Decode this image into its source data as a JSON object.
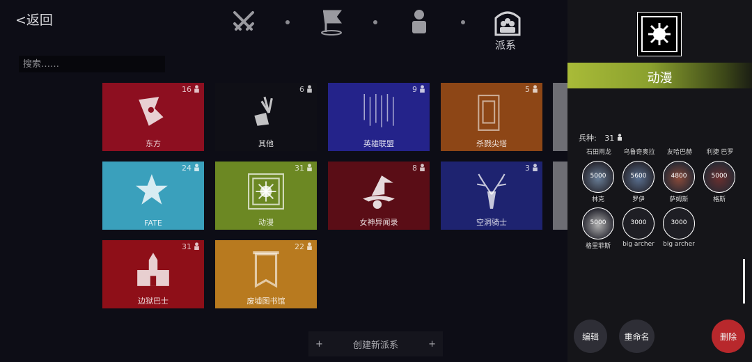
{
  "header": {
    "back_label": "<返回",
    "nav_icons": [
      "swords-icon",
      "flag-icon",
      "person-icon",
      "faction-icon"
    ],
    "nav_label": "派系"
  },
  "search": {
    "placeholder": "搜索……"
  },
  "factions": [
    {
      "name": "东方",
      "count": "16",
      "color": "#8d0f20",
      "icon": "shuriken-icon"
    },
    {
      "name": "其他",
      "count": "6",
      "color": "#0f0f16",
      "icon": "flower-hand-icon"
    },
    {
      "name": "英雄联盟",
      "count": "9",
      "color": "#24238a",
      "icon": "hanging-swords-icon"
    },
    {
      "name": "杀戮尖塔",
      "count": "5",
      "color": "#8d4616",
      "icon": "tower-card-icon"
    },
    {
      "name": "FATE",
      "count": "24",
      "color": "#3aa0bc",
      "icon": "star-badge-icon"
    },
    {
      "name": "动漫",
      "count": "31",
      "color": "#6c8823",
      "icon": "mace-frame-icon"
    },
    {
      "name": "女神异闻录",
      "count": "8",
      "color": "#5a0d16",
      "icon": "witch-hat-icon"
    },
    {
      "name": "空洞骑士",
      "count": "3",
      "color": "#1e2370",
      "icon": "antlers-icon"
    },
    {
      "name": "边狱巴士",
      "count": "31",
      "color": "#8e0f18",
      "icon": "castle-icon"
    },
    {
      "name": "废墟图书馆",
      "count": "22",
      "color": "#b87a1f",
      "icon": "banner-icon"
    }
  ],
  "create_button": {
    "label": "创建新派系",
    "plus": "+"
  },
  "panel": {
    "title": "动漫",
    "troops_label": "兵种:",
    "troops_count": "31",
    "heroes": [
      "石田雨龙",
      "乌鲁奇奥拉",
      "友哈巴赫",
      "利捷 巴罗"
    ],
    "units": [
      {
        "cost": "5000",
        "name": "林克"
      },
      {
        "cost": "5600",
        "name": "罗伊"
      },
      {
        "cost": "4800",
        "name": "萨姆斯"
      },
      {
        "cost": "5000",
        "name": "格斯"
      },
      {
        "cost": "5000",
        "name": "格里菲斯"
      },
      {
        "cost": "3000",
        "name": "big archer"
      },
      {
        "cost": "3000",
        "name": "big archer"
      }
    ],
    "edit_label": "编辑",
    "rename_label": "重命名",
    "delete_label": "删除",
    "colors": {
      "banner": "#a9bb38",
      "delete": "#b8282c",
      "button": "#2e2e36"
    }
  }
}
